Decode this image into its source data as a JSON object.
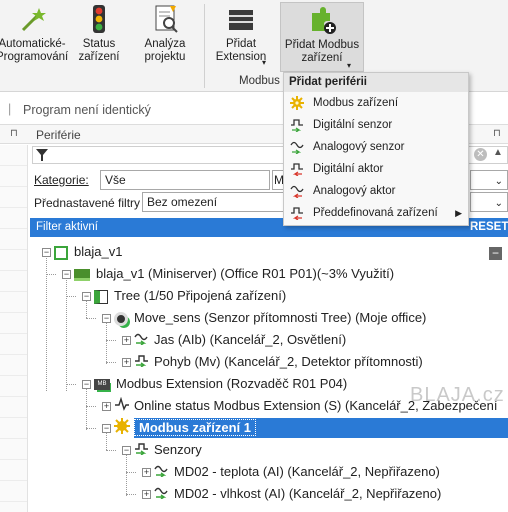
{
  "ribbon": {
    "buttons": [
      {
        "label": "Automatické-\nProgramování",
        "icon": "magic-wand-icon"
      },
      {
        "label": "Status\nzařízení",
        "icon": "traffic-light-icon"
      },
      {
        "label": "Analýza\nprojektu",
        "icon": "analysis-document-icon"
      },
      {
        "label": "Přidat\nExtension",
        "icon": "extension-device-icon"
      },
      {
        "label": "Přidat Modbus\nzařízení",
        "icon": "add-modbus-device-icon"
      }
    ],
    "group_label": "Modbus"
  },
  "status_text": "Program není identický",
  "panel": {
    "title": "Periférie",
    "category_label": "Kategorie:",
    "category_value": "Vše",
    "preset_label": "Přednastavené filtry",
    "preset_value": "Bez omezení",
    "second_select_initial": "M",
    "filter_active": "Filter aktivní",
    "reset": "RESET"
  },
  "menu": {
    "header": "Přidat periférii",
    "items": [
      {
        "label": "Modbus zařízení",
        "icon": "modbus-gear-icon",
        "color": "#e8b200"
      },
      {
        "label": "Digitální senzor",
        "icon": "digital-input-icon",
        "color": "#3ba53b"
      },
      {
        "label": "Analogový senzor",
        "icon": "analog-input-icon",
        "color": "#3ba53b"
      },
      {
        "label": "Digitální aktor",
        "icon": "digital-output-icon",
        "color": "#d9362b"
      },
      {
        "label": "Analogový aktor",
        "icon": "analog-output-icon",
        "color": "#d9362b"
      },
      {
        "label": "Předdefinovaná zařízení",
        "icon": "predefined-device-icon",
        "color": "#d9362b"
      }
    ]
  },
  "tree": {
    "root": "blaja_v1",
    "miniserver": "blaja_v1 (Miniserver) (Office R01 P01)(~3% Využití)",
    "tree_bus": "Tree  (1/50 Připojená zařízení)",
    "move_sens": "Move_sens (Senzor přítomnosti Tree) (Moje office)",
    "jas": "Jas (AIb) (Kancelář_2, Osvětlení)",
    "pohyb": "Pohyb (Mv) (Kancelář_2, Detektor přítomnosti)",
    "modbus_ext": "Modbus Extension (Rozvaděč R01 P04)",
    "online_status": "Online status Modbus Extension (S) (Kancelář_2, Zabezpečení",
    "modbus_device": "Modbus zařízení 1",
    "sensors": "Senzory",
    "md02_temp": "MD02 - teplota (AI) (Kancelář_2, Nepřiřazeno)",
    "md02_hum": "MD02 - vlhkost (AI) (Kancelář_2, Nepřiřazeno)"
  },
  "watermark": "BLAJA.cz",
  "colors": {
    "accent": "#2a7ad6",
    "online": "#36b24a",
    "warning": "#e8b200",
    "actor": "#d9362b"
  }
}
